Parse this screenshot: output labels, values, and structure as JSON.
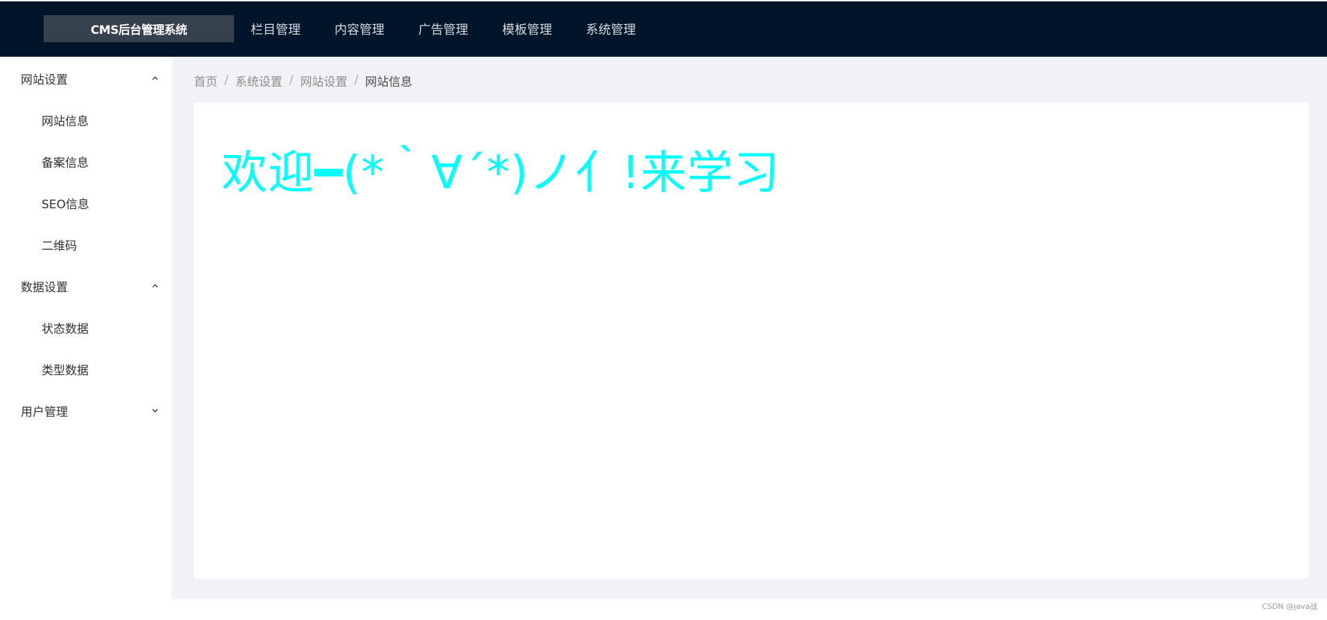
{
  "header": {
    "logo": "CMS后台管理系统",
    "nav": [
      "栏目管理",
      "内容管理",
      "广告管理",
      "模板管理",
      "系统管理"
    ]
  },
  "sidebar": {
    "groups": [
      {
        "title": "网站设置",
        "expanded": true,
        "arrow_icon": "chevron-up-icon",
        "items": [
          "网站信息",
          "备案信息",
          "SEO信息",
          "二维码"
        ]
      },
      {
        "title": "数据设置",
        "expanded": true,
        "arrow_icon": "chevron-up-icon",
        "items": [
          "状态数据",
          "类型数据"
        ]
      },
      {
        "title": "用户管理",
        "expanded": false,
        "arrow_icon": "chevron-down-icon",
        "items": []
      }
    ]
  },
  "breadcrumb": [
    "首页",
    "系统设置",
    "网站设置",
    "网站信息"
  ],
  "breadcrumb_separator": "/",
  "content": {
    "welcome_text": "欢迎━(*｀∀´*)ノ亻!来学习"
  },
  "watermark": "CSDN @java战",
  "colors": {
    "header_bg": "#00152a",
    "logo_bg": "#36414e",
    "main_bg": "#f0f2f5",
    "welcome_text": "#00ffff"
  }
}
